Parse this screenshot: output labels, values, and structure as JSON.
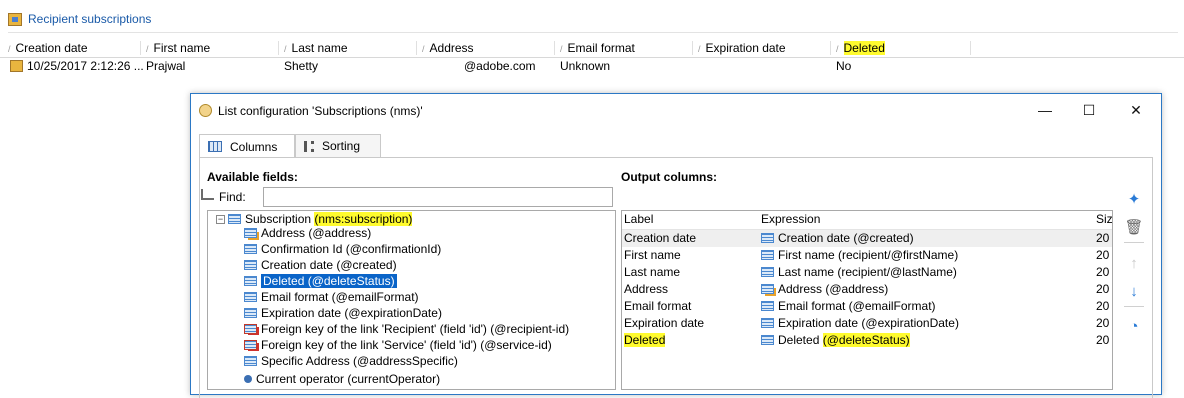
{
  "header": {
    "title": "Recipient subscriptions"
  },
  "grid": {
    "columns": [
      "Creation date",
      "First name",
      "Last name",
      "Address",
      "Email format",
      "Expiration date",
      "Deleted"
    ],
    "row": {
      "creation_date": "10/25/2017 2:12:26 ...",
      "first_name": "Prajwal",
      "last_name": "Shetty",
      "address": "@adobe.com",
      "email_format": "Unknown",
      "expiration_date": "",
      "deleted": "No"
    }
  },
  "dialog": {
    "title": "List configuration 'Subscriptions (nms)'",
    "window_buttons": {
      "minimize": "—",
      "maximize": "☐",
      "close": "✕"
    },
    "tabs": [
      "Columns",
      "Sorting"
    ],
    "available_label": "Available fields:",
    "find_label": "Find:",
    "find_value": "",
    "tree": {
      "root_label": "Subscription",
      "root_schema": "(nms:subscription)",
      "items": [
        "Address (@address)",
        "Confirmation Id (@confirmationId)",
        "Creation date (@created)",
        "Deleted (@deleteStatus)",
        "Email format (@emailFormat)",
        "Expiration date (@expirationDate)",
        "Foreign key of the link 'Recipient' (field 'id') (@recipient-id)",
        "Foreign key of the link 'Service' (field 'id') (@service-id)",
        "Specific Address (@addressSpecific)",
        "Current operator (currentOperator)"
      ]
    },
    "output_label": "Output columns:",
    "output_headers": {
      "label": "Label",
      "expression": "Expression",
      "size": "Size"
    },
    "output_rows": [
      {
        "label": "Creation date",
        "expression": "Creation date (@created)",
        "size": "20"
      },
      {
        "label": "First name",
        "expression": "First name (recipient/@firstName)",
        "size": "20"
      },
      {
        "label": "Last name",
        "expression": "Last name (recipient/@lastName)",
        "size": "20"
      },
      {
        "label": "Address",
        "expression": "Address (@address)",
        "size": "20"
      },
      {
        "label": "Email format",
        "expression": "Email format (@emailFormat)",
        "size": "20"
      },
      {
        "label": "Expiration date",
        "expression": "Expiration date (@expirationDate)",
        "size": "20"
      },
      {
        "label": "Deleted",
        "expression_prefix": "Deleted",
        "expression_hl": "(@deleteStatus)",
        "size": "20"
      }
    ]
  },
  "colors": {
    "highlight": "#fffb2e",
    "selection": "#0a64c8",
    "link": "#1a5aa8",
    "dialog_border": "#2b78c5"
  }
}
